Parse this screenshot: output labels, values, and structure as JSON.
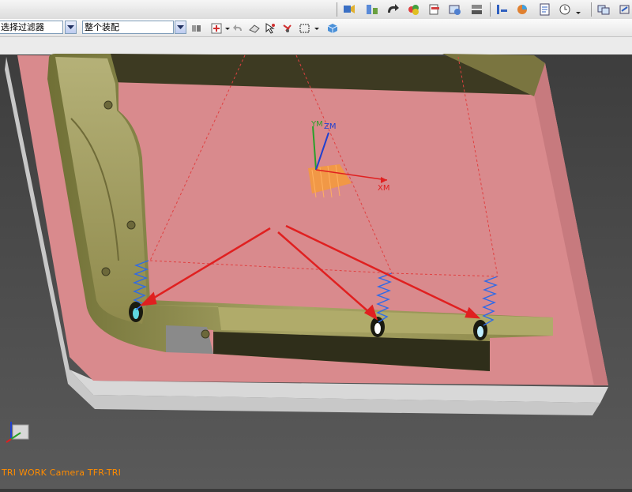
{
  "filter_bar": {
    "selection_filter": "选择过滤器",
    "assembly_scope": "整个装配"
  },
  "viewport": {
    "wcs_labels": {
      "y": "YM",
      "z": "ZM",
      "x": "XM"
    },
    "camera_caption": "TRI WORK Camera TFR-TRI"
  },
  "colors": {
    "toolbar_bg": "#e6e6e6",
    "viewport_bg": "#3a3a3a",
    "plate_pink": "#d8868a",
    "part_olive": "#9a9656",
    "arrow_red": "#e02020",
    "caption_orange": "#ff8c00"
  },
  "icons": [
    "camera-icon",
    "move-icon",
    "rotate-icon",
    "color-icon",
    "layer-icon",
    "render-icon",
    "section-icon",
    "measure-icon",
    "analysis-icon",
    "doc-icon",
    "clock-icon",
    "window-icon",
    "snap-icon",
    "undo-icon",
    "eraser-icon",
    "assembly-icon",
    "box-select-icon",
    "cube-icon"
  ]
}
